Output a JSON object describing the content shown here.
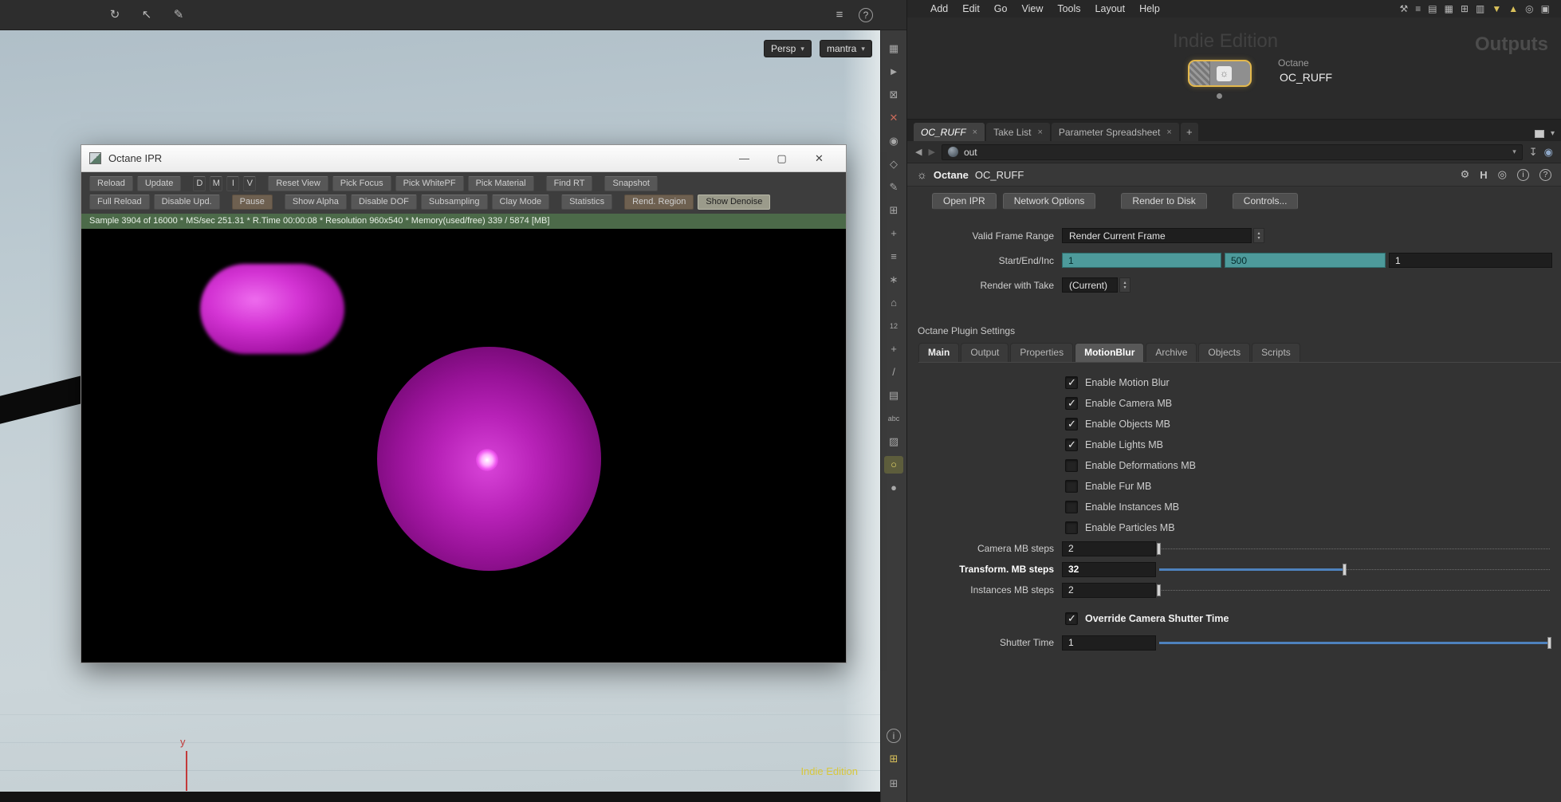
{
  "colors": {
    "accent_teal": "#4d9a9b",
    "slider_blue": "#4e82bd",
    "node_select_yellow": "#e3b84d",
    "status_green": "#4c6a49",
    "render_magenta": "#cc22cc",
    "watermark_yellow": "#d8c83c"
  },
  "left_viewport": {
    "toolbar_icons": [
      {
        "name": "orbit-tool-icon",
        "glyph": "↻"
      },
      {
        "name": "select-tool-icon",
        "glyph": "↖"
      },
      {
        "name": "lasso-tool-icon",
        "glyph": "✎"
      }
    ],
    "tree_icon": "≡",
    "help_icon": "?",
    "persp_menu": {
      "label": "Persp",
      "caret": "▾"
    },
    "renderer_menu": {
      "label": "mantra",
      "caret": "▾"
    },
    "axis_label": "y",
    "watermark": "Indie Edition"
  },
  "ipr": {
    "title": "Octane IPR",
    "window_controls": {
      "minimize": "—",
      "maximize": "▢",
      "close": "✕"
    },
    "row1": [
      {
        "label": "Reload"
      },
      {
        "label": "Update"
      },
      {
        "label": "D"
      },
      {
        "label": "M"
      },
      {
        "label": "I"
      },
      {
        "label": "V"
      },
      {
        "label": "Reset View"
      },
      {
        "label": "Pick Focus"
      },
      {
        "label": "Pick WhitePF"
      },
      {
        "label": "Pick Material"
      },
      {
        "label": "Find RT"
      },
      {
        "label": "Snapshot"
      }
    ],
    "row2": [
      {
        "label": "Full Reload"
      },
      {
        "label": "Disable Upd."
      },
      {
        "label": "Pause"
      },
      {
        "label": "Show Alpha"
      },
      {
        "label": "Disable DOF"
      },
      {
        "label": "Subsampling"
      },
      {
        "label": "Clay Mode"
      },
      {
        "label": "Statistics"
      },
      {
        "label": "Rend. Region"
      },
      {
        "label": "Show Denoise",
        "active": true
      }
    ],
    "status": "Sample 3904 of 16000 * MS/sec 251.31 * R.Time 00:00:08 * Resolution 960x540 * Memory(used/free) 339 / 5874 [MB]"
  },
  "menubar": {
    "items": [
      "Add",
      "Edit",
      "Go",
      "View",
      "Tools",
      "Layout",
      "Help"
    ],
    "icons": [
      {
        "name": "tools-icon",
        "glyph": "⚒"
      },
      {
        "name": "list-icon",
        "glyph": "≡"
      },
      {
        "name": "rows-icon",
        "glyph": "▤"
      },
      {
        "name": "grid-icon",
        "glyph": "▦"
      },
      {
        "name": "table-icon",
        "glyph": "⊞"
      },
      {
        "name": "columns-icon",
        "glyph": "▥"
      },
      {
        "name": "save-icon",
        "glyph": "▼"
      },
      {
        "name": "export-icon",
        "glyph": "▲"
      },
      {
        "name": "search-icon",
        "glyph": "◎"
      },
      {
        "name": "help-book-icon",
        "glyph": "▣"
      }
    ]
  },
  "network": {
    "watermark": "Indie Edition",
    "pane_label": "Outputs",
    "node": {
      "type_label": "Octane",
      "name": "OC_RUFF",
      "icon": "☼"
    }
  },
  "tabs": {
    "items": [
      {
        "label": "OC_RUFF",
        "close": "×",
        "selected": true
      },
      {
        "label": "Take List",
        "close": "×",
        "selected": false
      },
      {
        "label": "Parameter Spreadsheet",
        "close": "×",
        "selected": false
      }
    ],
    "add_label": "+",
    "caret": "▾"
  },
  "pathbar": {
    "back": "◀",
    "forward": "▶",
    "path": "out",
    "caret": "▾",
    "pin_icon": "↧",
    "recook_icon": "◉"
  },
  "node_header": {
    "icon": "☼",
    "type": "Octane",
    "name": "OC_RUFF",
    "gear_icon": "⚙",
    "houdini_icon": "H",
    "search_icon": "◎",
    "info_icon": "i",
    "help_icon": "?"
  },
  "actions": [
    {
      "label": "Open IPR"
    },
    {
      "label": "Network Options"
    },
    {
      "label": "Render to Disk"
    },
    {
      "label": "Controls..."
    }
  ],
  "params": {
    "valid_frame_range": {
      "label": "Valid Frame Range",
      "value": "Render Current Frame"
    },
    "start_end_inc": {
      "label": "Start/End/Inc",
      "start": "1",
      "end": "500",
      "inc": "1"
    },
    "render_with_take": {
      "label": "Render with Take",
      "value": "(Current)"
    }
  },
  "ui": {
    "spin_up": "▴",
    "spin_down": "▾"
  },
  "plugin": {
    "section_title": "Octane Plugin Settings",
    "tabs": [
      {
        "label": "Main",
        "selected": false,
        "emph": true
      },
      {
        "label": "Output",
        "selected": false,
        "emph": false
      },
      {
        "label": "Properties",
        "selected": false,
        "emph": false
      },
      {
        "label": "MotionBlur",
        "selected": true,
        "emph": false
      },
      {
        "label": "Archive",
        "selected": false,
        "emph": false
      },
      {
        "label": "Objects",
        "selected": false,
        "emph": false
      },
      {
        "label": "Scripts",
        "selected": false,
        "emph": false
      }
    ],
    "checkboxes": [
      {
        "label": "Enable Motion Blur",
        "checked": true
      },
      {
        "label": "Enable Camera MB",
        "checked": true
      },
      {
        "label": "Enable Objects MB",
        "checked": true
      },
      {
        "label": "Enable Lights MB",
        "checked": true
      },
      {
        "label": "Enable Deformations MB",
        "checked": false
      },
      {
        "label": "Enable Fur MB",
        "checked": false
      },
      {
        "label": "Enable Instances MB",
        "checked": false
      },
      {
        "label": "Enable Particles MB",
        "checked": false
      }
    ],
    "sliders": [
      {
        "label": "Camera MB steps",
        "value": "2",
        "fill": "0%",
        "emph": false
      },
      {
        "label": "Transform. MB steps",
        "value": "32",
        "fill": "47.5%",
        "emph": true
      },
      {
        "label": "Instances MB steps",
        "value": "2",
        "fill": "0%",
        "emph": false
      }
    ],
    "override_shutter": {
      "label": "Override Camera Shutter Time",
      "checked": true
    },
    "shutter": {
      "label": "Shutter Time",
      "value": "1",
      "fill": "100%"
    }
  },
  "right_strip": {
    "icons": [
      {
        "name": "view-layout-icon",
        "glyph": "▦"
      },
      {
        "name": "select-arrow-icon",
        "glyph": "►"
      },
      {
        "name": "lock-icon",
        "glyph": "⊠"
      },
      {
        "name": "delete-icon",
        "glyph": "✕"
      },
      {
        "name": "magnet-icon",
        "glyph": "◉"
      },
      {
        "name": "mirror-icon",
        "glyph": "◇"
      },
      {
        "name": "draw-icon",
        "glyph": "✎"
      },
      {
        "name": "grid-icon",
        "glyph": "⊞"
      },
      {
        "name": "transform-icon",
        "glyph": "+"
      },
      {
        "name": "list-icon",
        "glyph": "≡"
      },
      {
        "name": "star-icon",
        "glyph": "∗"
      },
      {
        "name": "home-icon",
        "glyph": "⌂"
      },
      {
        "name": "steps-icon",
        "glyph": "12"
      },
      {
        "name": "add-icon",
        "glyph": "+"
      },
      {
        "name": "knife-icon",
        "glyph": "/"
      },
      {
        "name": "layers-icon",
        "glyph": "▤"
      },
      {
        "name": "text-icon",
        "glyph": "abc"
      },
      {
        "name": "image-icon",
        "glyph": "▨"
      },
      {
        "name": "light-bulb-icon",
        "glyph": "○"
      },
      {
        "name": "dot-icon",
        "glyph": "●"
      }
    ],
    "info_icon": "i",
    "cells_yellow_icon": "⊞",
    "cells_gray_icon": "⊞"
  }
}
